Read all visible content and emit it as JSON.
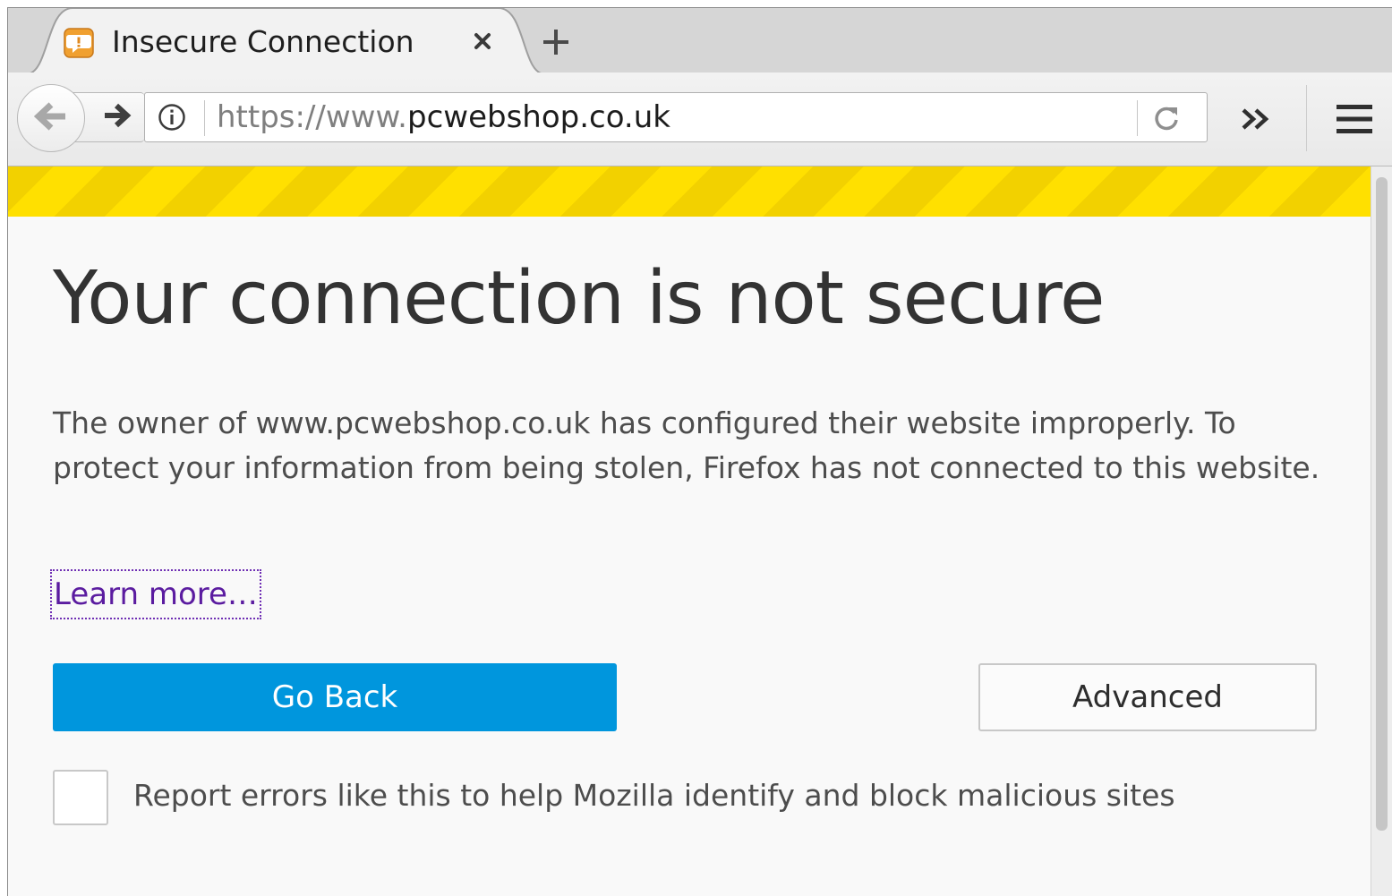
{
  "tab": {
    "title": "Insecure Connection",
    "favicon": "warning-speech-icon",
    "close_glyph": "✖",
    "new_tab_glyph": "+"
  },
  "navbar": {
    "url_scheme": "https://www.",
    "url_domain": "pcwebshop.co.uk",
    "icons": [
      "back-arrow-icon",
      "forward-arrow-icon",
      "info-icon",
      "reload-icon",
      "overflow-chevron-icon",
      "hamburger-menu-icon"
    ]
  },
  "page": {
    "title": "Your connection is not secure",
    "description": "The owner of www.pcwebshop.co.uk has configured their website improperly. To protect your information from being stolen, Firefox has not connected to this website.",
    "learn_more": "Learn more…",
    "go_back": "Go Back",
    "advanced": "Advanced",
    "report_label": "Report errors like this to help Mozilla identify and block malicious sites",
    "report_checked": false
  },
  "colors": {
    "stripe_yellow": "#ffe000",
    "stripe_dark": "#f2d100",
    "primary_button": "#0096dd",
    "link_purple": "#5b1ca0",
    "favicon_orange": "#f0a030"
  }
}
